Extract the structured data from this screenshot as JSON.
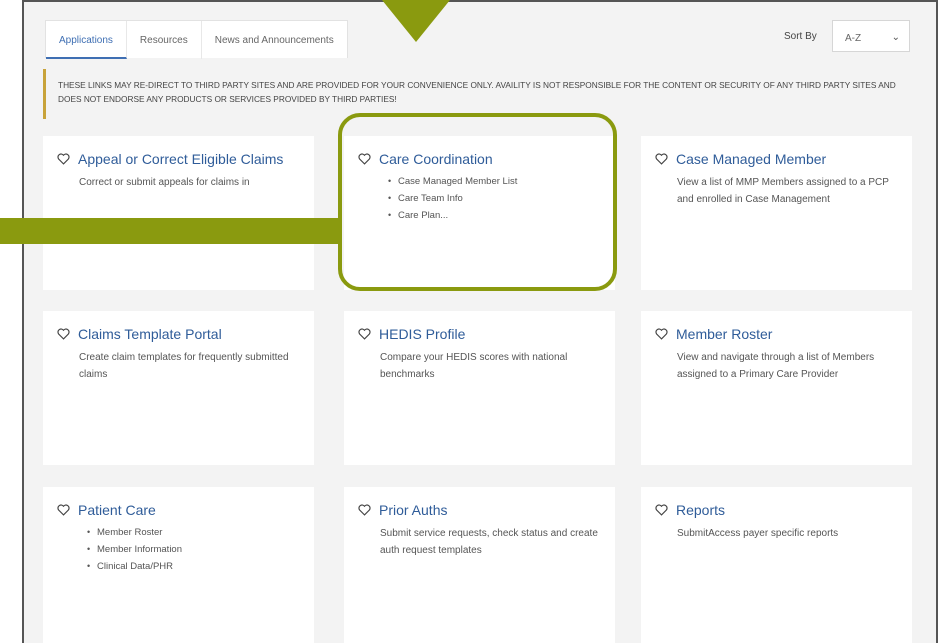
{
  "tabs": [
    {
      "label": "Applications"
    },
    {
      "label": "Resources"
    },
    {
      "label": "News and Announcements"
    }
  ],
  "sort": {
    "label": "Sort By",
    "value": "A-Z"
  },
  "notice": "These links may re-direct to third party sites and are provided for your convenience only. Availity is not responsible for the content or security of any third party sites and does not endorse any products or services provided by third parties!",
  "cards": [
    {
      "title": "Appeal or Correct Eligible Claims",
      "desc": "Correct or submit appeals for claims in"
    },
    {
      "title": "Care Coordination",
      "items": [
        "Case Managed Member List",
        "Care Team Info",
        "Care Plan..."
      ]
    },
    {
      "title": "Case Managed Member",
      "desc": "View a list of MMP Members assigned to a PCP and enrolled in Case Management"
    },
    {
      "title": "Claims Template Portal",
      "desc": "Create claim templates for frequently submitted claims"
    },
    {
      "title": "HEDIS Profile",
      "desc": "Compare your HEDIS scores with national benchmarks"
    },
    {
      "title": "Member Roster",
      "desc": "View and navigate through a list of Members assigned to a Primary Care Provider"
    },
    {
      "title": "Patient Care",
      "items": [
        "Member Roster",
        "Member Information",
        "Clinical Data/PHR"
      ]
    },
    {
      "title": "Prior Auths",
      "desc": "Submit service requests, check status and create auth request templates"
    },
    {
      "title": "Reports",
      "desc": "SubmitAccess payer specific reports"
    }
  ],
  "colors": {
    "accent": "#3f6fb3",
    "highlight": "#8a9a0f",
    "notice_bar": "#c8a33a"
  }
}
